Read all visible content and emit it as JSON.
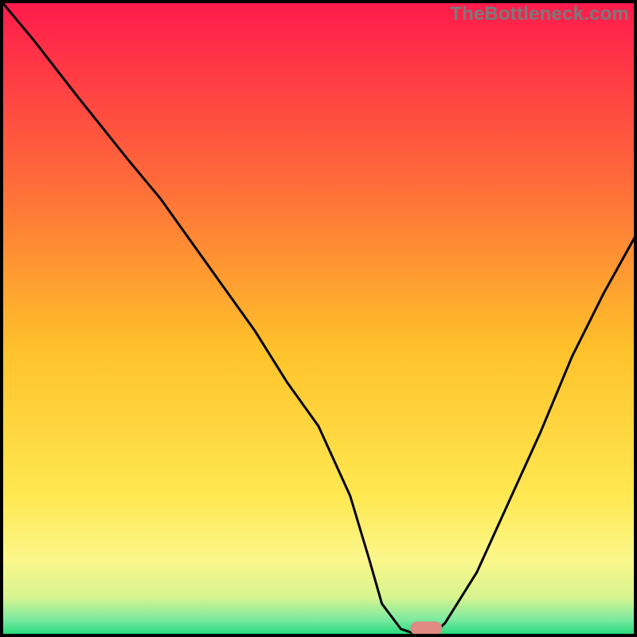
{
  "watermark": "TheBottleneck.com",
  "chart_data": {
    "type": "line",
    "title": "",
    "xlabel": "",
    "ylabel": "",
    "xlim": [
      0,
      100
    ],
    "ylim": [
      0,
      100
    ],
    "grid": false,
    "legend": false,
    "series": [
      {
        "name": "bottleneck-curve",
        "x": [
          0,
          5,
          12,
          20,
          25,
          30,
          35,
          40,
          45,
          50,
          55,
          58,
          60,
          63,
          66,
          68,
          70,
          75,
          80,
          85,
          90,
          95,
          100
        ],
        "values": [
          100,
          94,
          85,
          75,
          69,
          62,
          55,
          48,
          40,
          33,
          22,
          12,
          5,
          1,
          0,
          0,
          2,
          10,
          21,
          32,
          44,
          54,
          63
        ]
      }
    ],
    "marker": {
      "x": 67,
      "y": 0,
      "width": 5,
      "height": 2.2,
      "color": "#e08a83"
    },
    "background_gradient": {
      "stops": [
        {
          "offset": 0,
          "color": "#ff1a4c"
        },
        {
          "offset": 0.28,
          "color": "#ff6a3a"
        },
        {
          "offset": 0.55,
          "color": "#ffc22a"
        },
        {
          "offset": 0.78,
          "color": "#ffe851"
        },
        {
          "offset": 0.88,
          "color": "#fbf78a"
        },
        {
          "offset": 0.94,
          "color": "#d7f48f"
        },
        {
          "offset": 0.975,
          "color": "#7ceaa0"
        },
        {
          "offset": 1.0,
          "color": "#1ed97a"
        }
      ]
    }
  }
}
